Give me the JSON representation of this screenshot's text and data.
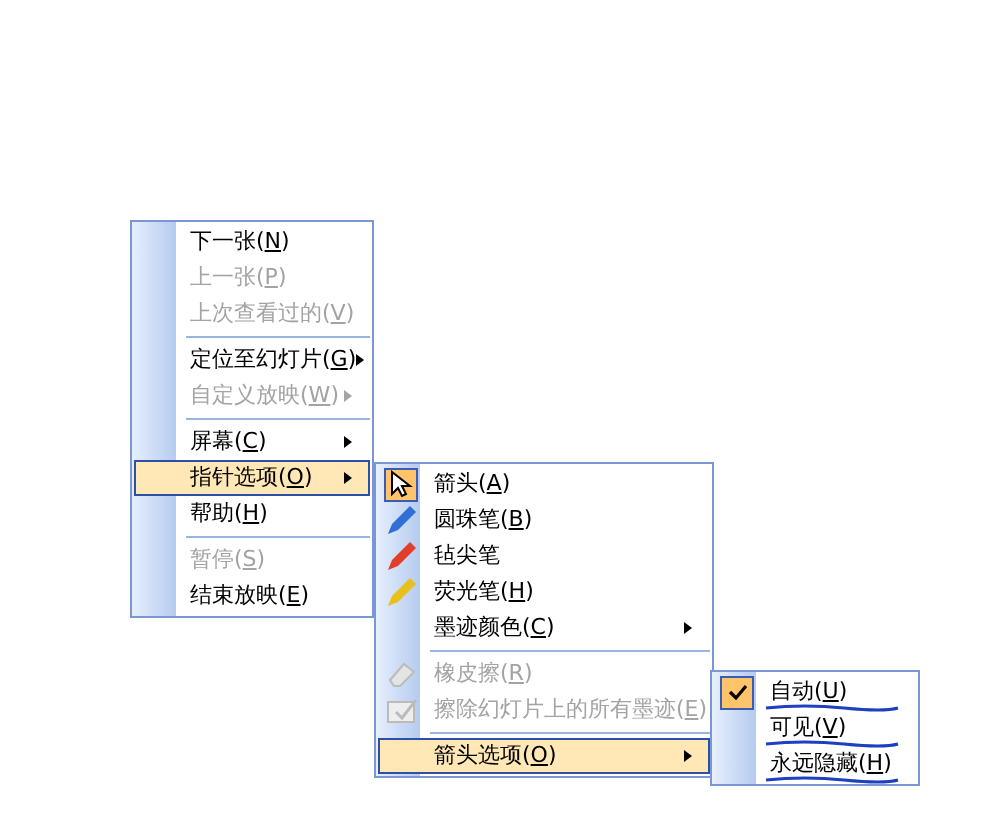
{
  "menus": [
    {
      "items": [
        {
          "kind": "command",
          "label": "下一张(N)",
          "disabled": false,
          "highlighted": false,
          "submenu": false
        },
        {
          "kind": "command",
          "label": "上一张(P)",
          "disabled": true,
          "highlighted": false,
          "submenu": false
        },
        {
          "kind": "command",
          "label": "上次查看过的(V)",
          "disabled": true,
          "highlighted": false,
          "submenu": false
        },
        {
          "kind": "separator"
        },
        {
          "kind": "command",
          "label": "定位至幻灯片(G)",
          "disabled": false,
          "highlighted": false,
          "submenu": true
        },
        {
          "kind": "command",
          "label": "自定义放映(W)",
          "disabled": true,
          "highlighted": false,
          "submenu": true
        },
        {
          "kind": "separator"
        },
        {
          "kind": "command",
          "label": "屏幕(C)",
          "disabled": false,
          "highlighted": false,
          "submenu": true
        },
        {
          "kind": "command",
          "label": "指针选项(O)",
          "disabled": false,
          "highlighted": true,
          "submenu": true
        },
        {
          "kind": "command",
          "label": "帮助(H)",
          "disabled": false,
          "highlighted": false,
          "submenu": false
        },
        {
          "kind": "separator"
        },
        {
          "kind": "command",
          "label": "暂停(S)",
          "disabled": true,
          "highlighted": false,
          "submenu": false
        },
        {
          "kind": "command",
          "label": "结束放映(E)",
          "disabled": false,
          "highlighted": false,
          "submenu": false
        }
      ]
    },
    {
      "items": [
        {
          "kind": "pointer",
          "label": "箭头(A)",
          "disabled": false,
          "highlighted": false,
          "submenu": false,
          "selected": true
        },
        {
          "kind": "pen",
          "label": "圆珠笔(B)",
          "disabled": false,
          "highlighted": false,
          "submenu": false,
          "selected": false,
          "color": "#2f6fd6"
        },
        {
          "kind": "pen",
          "label": "毡尖笔",
          "disabled": false,
          "highlighted": false,
          "submenu": false,
          "selected": false,
          "color": "#e0402a"
        },
        {
          "kind": "pen",
          "label": "荧光笔(H)",
          "disabled": false,
          "highlighted": false,
          "submenu": false,
          "selected": false,
          "color": "#e8c01c"
        },
        {
          "kind": "command",
          "label": "墨迹颜色(C)",
          "disabled": false,
          "highlighted": false,
          "submenu": true
        },
        {
          "kind": "separator"
        },
        {
          "kind": "eraser",
          "label": "橡皮擦(R)",
          "disabled": true,
          "highlighted": false,
          "submenu": false
        },
        {
          "kind": "erase-all",
          "label": "擦除幻灯片上的所有墨迹(E)",
          "disabled": true,
          "highlighted": false,
          "submenu": false
        },
        {
          "kind": "separator"
        },
        {
          "kind": "command",
          "label": "箭头选项(O)",
          "disabled": false,
          "highlighted": true,
          "submenu": true
        }
      ]
    },
    {
      "items": [
        {
          "kind": "option",
          "label": "自动(U)",
          "disabled": false,
          "highlighted": false,
          "submenu": false,
          "checked": true,
          "underlined": true
        },
        {
          "kind": "option",
          "label": "可见(V)",
          "disabled": false,
          "highlighted": false,
          "submenu": false,
          "checked": false,
          "underlined": true
        },
        {
          "kind": "option",
          "label": "永远隐藏(H)",
          "disabled": false,
          "highlighted": false,
          "submenu": false,
          "checked": false,
          "underlined": true
        }
      ]
    }
  ]
}
